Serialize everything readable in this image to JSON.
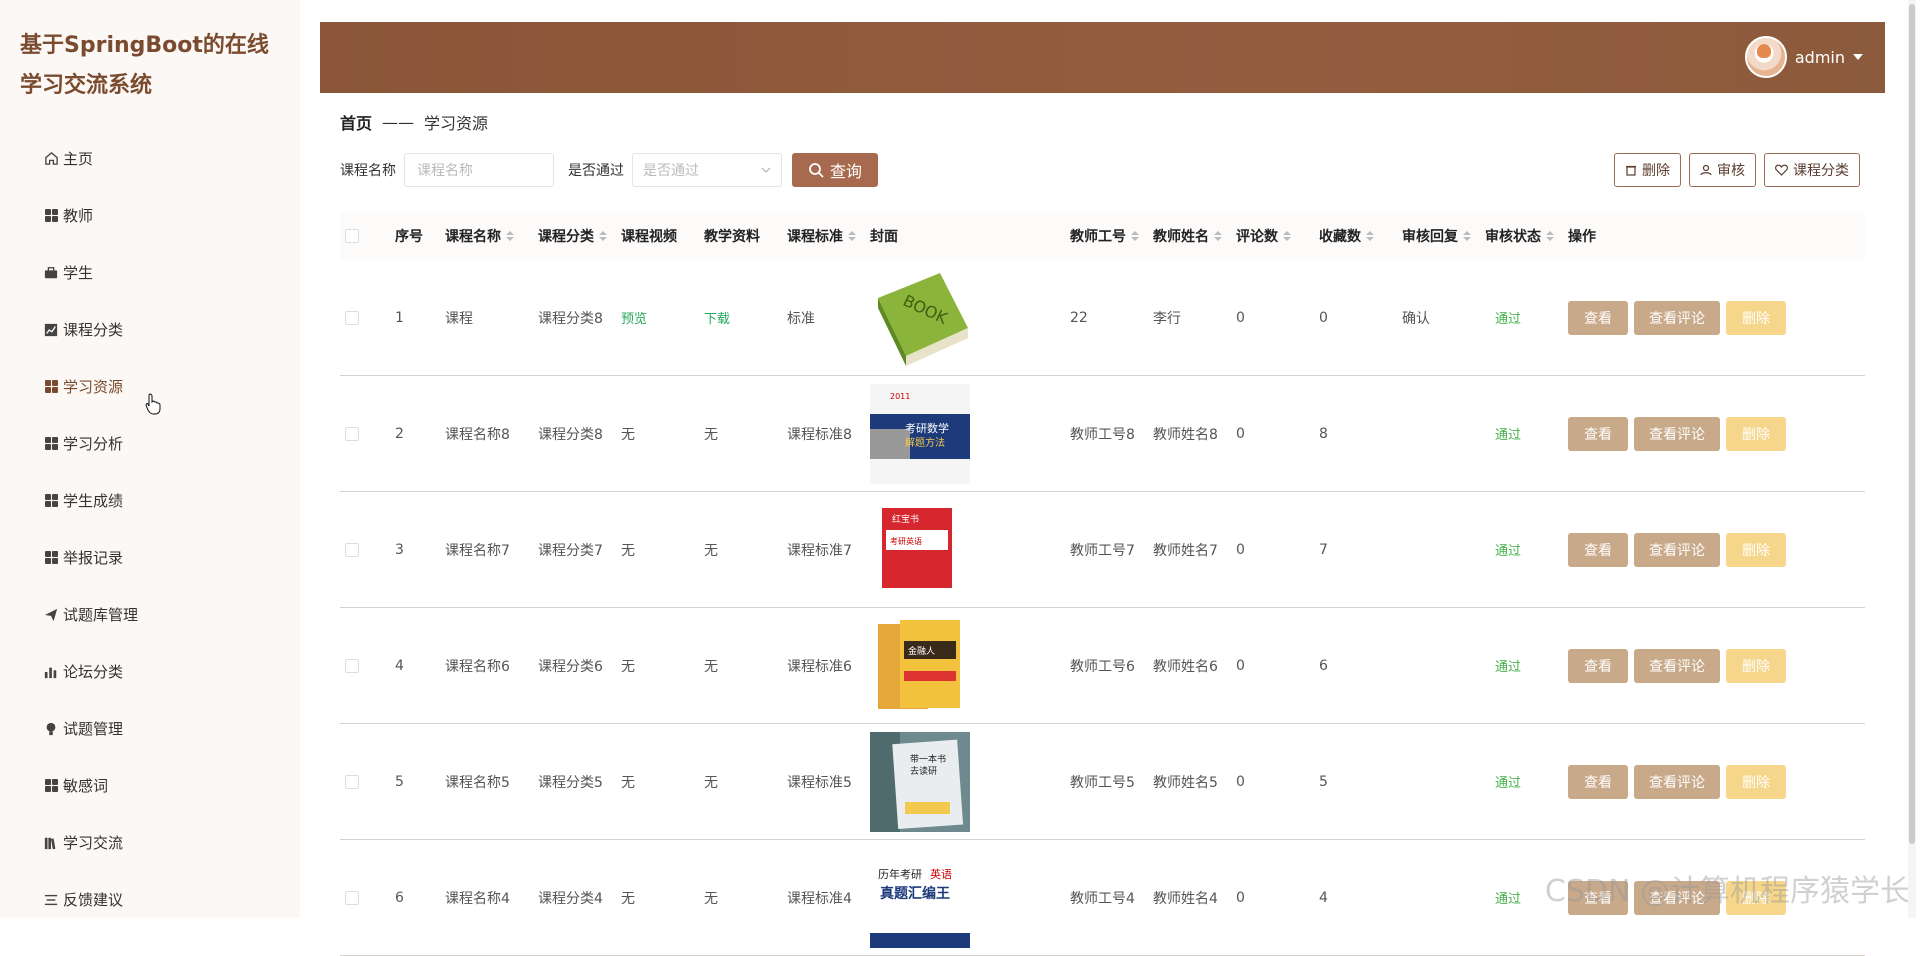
{
  "app": {
    "title": "基于SpringBoot的在线学习交流系统"
  },
  "sidebar": {
    "items": [
      {
        "label": "主页",
        "icon": "home-icon"
      },
      {
        "label": "教师",
        "icon": "grid-icon"
      },
      {
        "label": "学生",
        "icon": "briefcase-icon"
      },
      {
        "label": "课程分类",
        "icon": "chart-icon"
      },
      {
        "label": "学习资源",
        "icon": "grid-icon",
        "active": true
      },
      {
        "label": "学习分析",
        "icon": "grid-icon"
      },
      {
        "label": "学生成绩",
        "icon": "grid-icon"
      },
      {
        "label": "举报记录",
        "icon": "grid-icon"
      },
      {
        "label": "试题库管理",
        "icon": "send-icon"
      },
      {
        "label": "论坛分类",
        "icon": "bar-chart-icon"
      },
      {
        "label": "试题管理",
        "icon": "lightbulb-icon"
      },
      {
        "label": "敏感词",
        "icon": "grid-icon"
      },
      {
        "label": "学习交流",
        "icon": "books-icon"
      },
      {
        "label": "反馈建议",
        "icon": "filter-icon"
      }
    ]
  },
  "header": {
    "user": "admin"
  },
  "breadcrumb": {
    "home": "首页",
    "separator": "——",
    "current": "学习资源"
  },
  "filters": {
    "course_name_label": "课程名称",
    "course_name_placeholder": "课程名称",
    "passed_label": "是否通过",
    "passed_placeholder": "是否通过",
    "search_label": "查询"
  },
  "toolbar": {
    "delete_label": "删除",
    "audit_label": "审核",
    "category_label": "课程分类"
  },
  "table": {
    "headers": {
      "no": "序号",
      "name": "课程名称",
      "category": "课程分类",
      "video": "课程视频",
      "material": "教学资料",
      "standard": "课程标准",
      "cover": "封面",
      "teacher_no": "教师工号",
      "teacher_name": "教师姓名",
      "comments": "评论数",
      "favorites": "收藏数",
      "reply": "审核回复",
      "status": "审核状态",
      "ops": "操作"
    },
    "rows": [
      {
        "no": "1",
        "name": "课程",
        "category": "课程分类8",
        "video": "预览",
        "material": "下载",
        "standard": "标准",
        "cover": "book-green",
        "teacher_no": "22",
        "teacher_name": "李行",
        "comments": "0",
        "favorites": "0",
        "reply": "确认",
        "status": "通过"
      },
      {
        "no": "2",
        "name": "课程名称8",
        "category": "课程分类8",
        "video": "无",
        "material": "无",
        "standard": "课程标准8",
        "cover": "book-math",
        "teacher_no": "教师工号8",
        "teacher_name": "教师姓名8",
        "comments": "0",
        "favorites": "8",
        "reply": "",
        "status": "通过"
      },
      {
        "no": "3",
        "name": "课程名称7",
        "category": "课程分类7",
        "video": "无",
        "material": "无",
        "standard": "课程标准7",
        "cover": "book-red",
        "teacher_no": "教师工号7",
        "teacher_name": "教师姓名7",
        "comments": "0",
        "favorites": "7",
        "reply": "",
        "status": "通过"
      },
      {
        "no": "4",
        "name": "课程名称6",
        "category": "课程分类6",
        "video": "无",
        "material": "无",
        "standard": "课程标准6",
        "cover": "book-yellow",
        "teacher_no": "教师工号6",
        "teacher_name": "教师姓名6",
        "comments": "0",
        "favorites": "6",
        "reply": "",
        "status": "通过"
      },
      {
        "no": "5",
        "name": "课程名称5",
        "category": "课程分类5",
        "video": "无",
        "material": "无",
        "standard": "课程标准5",
        "cover": "book-photo",
        "teacher_no": "教师工号5",
        "teacher_name": "教师姓名5",
        "comments": "0",
        "favorites": "5",
        "reply": "",
        "status": "通过"
      },
      {
        "no": "6",
        "name": "课程名称4",
        "category": "课程分类4",
        "video": "无",
        "material": "无",
        "standard": "课程标准4",
        "cover": "book-english",
        "teacher_no": "教师工号4",
        "teacher_name": "教师姓名4",
        "comments": "0",
        "favorites": "4",
        "reply": "",
        "status": "通过"
      }
    ],
    "ops": {
      "view": "查看",
      "view_comments": "查看评论",
      "delete": "删除"
    }
  },
  "watermark": "CSDN @计算机程序猿学长",
  "colors": {
    "brand": "#8a5538",
    "button": "#a86a4e",
    "op_button": "#c8a98a",
    "delete_button": "#f6d68a",
    "status": "#45b049"
  }
}
